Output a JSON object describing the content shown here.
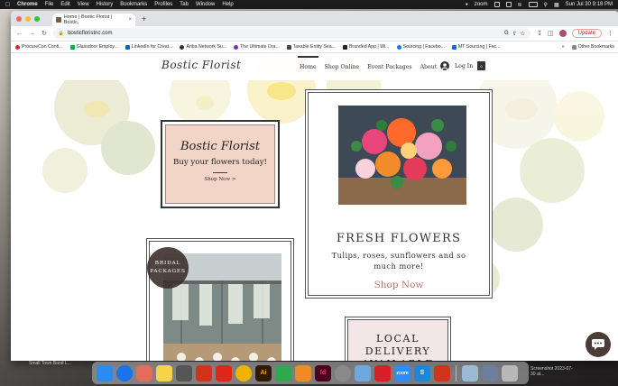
{
  "menubar": {
    "app": "Chrome",
    "items": [
      "File",
      "Edit",
      "View",
      "History",
      "Bookmarks",
      "Profiles",
      "Tab",
      "Window",
      "Help"
    ],
    "zoom_label": "zoom",
    "datetime": "Sun Jul 30  9:18 PM"
  },
  "browser": {
    "tab_title": "Home | Bostic Florist | Bostic,",
    "url": "bosticfloristnc.com",
    "update_label": "Update",
    "bookmarks": [
      {
        "label": "ProcureCon Conti...",
        "color": "#d9262c"
      },
      {
        "label": "Glassdoor Employ...",
        "color": "#0caa41"
      },
      {
        "label": "LinkedIn for Creat...",
        "color": "#0a66c2"
      },
      {
        "label": "Ariba Network Su...",
        "color": "#333333"
      },
      {
        "label": "The Ultimate Dra...",
        "color": "#7b2cbf"
      },
      {
        "label": "Taxable Entity Sea...",
        "color": "#444444"
      },
      {
        "label": "Branded App | Wi...",
        "color": "#222222"
      },
      {
        "label": "Sourcing | Facebo...",
        "color": "#1877f2"
      },
      {
        "label": "MT Sourcing | Fac...",
        "color": "#0866ff"
      }
    ],
    "other_bookmarks": "Other Bookmarks"
  },
  "site": {
    "logo": "Bostic Florist",
    "nav": [
      "Home",
      "Shop Online",
      "Event Packages",
      "About"
    ],
    "login": "Log In",
    "cart_count": "0",
    "hero": {
      "title": "Bostic Florist",
      "subtitle": "Buy your flowers today!",
      "link": "Shop Now >"
    },
    "fresh": {
      "title": "FRESH FLOWERS",
      "subtitle": "Tulips, roses, sunflowers and so much more!",
      "link": "Shop Now"
    },
    "bridal": {
      "badge": "BRIDAL PACKAGES"
    },
    "local": {
      "title": "LOCAL DELIVERY AVAILABLE"
    }
  },
  "desktop": {
    "left_label": "Small Town Band L...",
    "right_label": "Screenshot 2023-07-30 at..."
  },
  "dock": {
    "apps": [
      {
        "name": "finder",
        "color": "#2b8cf0",
        "glyph": ""
      },
      {
        "name": "safari",
        "color": "#1a73e8",
        "glyph": ""
      },
      {
        "name": "launchpad",
        "color": "#e26d5c",
        "glyph": ""
      },
      {
        "name": "notes",
        "color": "#f5d547",
        "glyph": ""
      },
      {
        "name": "calculator",
        "color": "#555555",
        "glyph": ""
      },
      {
        "name": "acrobat",
        "color": "#d0321b",
        "glyph": ""
      },
      {
        "name": "acrobat-reader",
        "color": "#e0251b",
        "glyph": ""
      },
      {
        "name": "chrome",
        "color": "#f0b400",
        "glyph": ""
      },
      {
        "name": "illustrator",
        "color": "#2f1b05",
        "glyph": "Ai"
      },
      {
        "name": "numbers",
        "color": "#2fa84f",
        "glyph": ""
      },
      {
        "name": "pages",
        "color": "#f08a24",
        "glyph": ""
      },
      {
        "name": "indesign",
        "color": "#49021f",
        "glyph": "Id"
      },
      {
        "name": "system-preferences",
        "color": "#8a8a8a",
        "glyph": ""
      },
      {
        "name": "preview",
        "color": "#6fa8dc",
        "glyph": ""
      },
      {
        "name": "creative-cloud",
        "color": "#da1f26",
        "glyph": ""
      },
      {
        "name": "zoom",
        "color": "#2d8cff",
        "glyph": "zoom"
      },
      {
        "name": "snagit",
        "color": "#1b87d6",
        "glyph": "S"
      },
      {
        "name": "acrobat-2",
        "color": "#d0321b",
        "glyph": ""
      },
      {
        "name": "downloads",
        "color": "#9bbbd4",
        "glyph": ""
      },
      {
        "name": "documents",
        "color": "#6b7f9a",
        "glyph": ""
      },
      {
        "name": "trash",
        "color": "#b8b8b8",
        "glyph": ""
      }
    ]
  }
}
